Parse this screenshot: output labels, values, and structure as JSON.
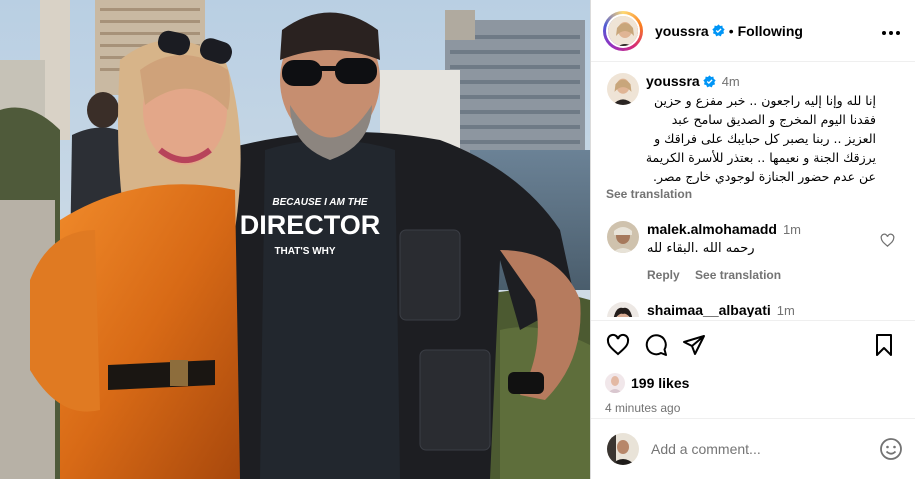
{
  "post": {
    "username": "youssra",
    "follow_label": "Following",
    "separator": "•",
    "more_label": "···"
  },
  "caption": {
    "username": "youssra",
    "time": "4m",
    "lines": [
      "إنا لله وإنا إليه راجعون .. خبر مفزع و حزين",
      "فقدنا اليوم المخرج و الصديق سامح عبد",
      "العزيز .. ربنا يصبر كل حبايبك على فراقك و",
      "يرزقك الجنة و نعيمها .. بعتذر للأسرة الكريمة",
      "عن عدم حضور الجنازة لوجودي خارج مصر."
    ],
    "see_translation": "See translation"
  },
  "comments": [
    {
      "username": "malek.almohamadd",
      "time": "1m",
      "text": "رحمه الله .البقاء لله",
      "reply_label": "Reply",
      "see_translation": "See translation"
    },
    {
      "username": "shaimaa__albayati",
      "time": "1m"
    }
  ],
  "likes": {
    "count_label": "199 likes"
  },
  "timestamp": "4 minutes ago",
  "add_comment": {
    "placeholder": "Add a comment..."
  },
  "photo": {
    "shirt_line1": "BECAUSE I AM THE",
    "shirt_line2": "DIRECTOR",
    "shirt_line3": "THAT'S WHY"
  },
  "icons": {
    "like": "heart-icon",
    "comment": "comment-bubble-icon",
    "share": "paper-plane-icon",
    "save": "bookmark-icon",
    "verified": "verified-badge-icon",
    "emoji": "smiley-icon"
  },
  "colors": {
    "verified": "#0095f6",
    "secondary_text": "#737373",
    "border": "#dbdbdb"
  }
}
